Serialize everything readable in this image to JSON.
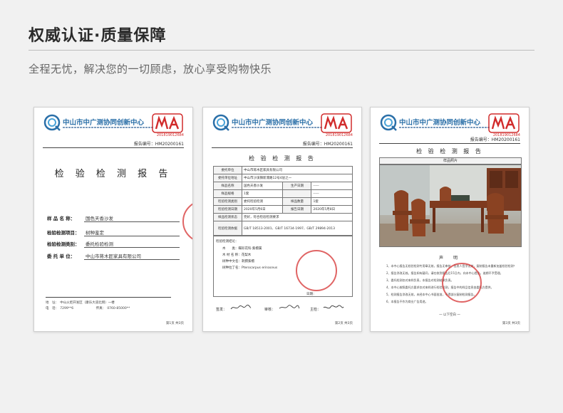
{
  "header": {
    "title": "权威认证·质量保障",
    "subtitle": "全程无忧，解决您的一切顾虑，放心享受购物快乐"
  },
  "doc_common": {
    "org_name": "中山市中广测协同创新中心",
    "cma_code": "201819012684",
    "report_no": "报告编号：HM20200161"
  },
  "doc1": {
    "title": "检 验 检 测 报 告",
    "fields": [
      {
        "label": "样 品 名 称：",
        "value": "国色天香沙发"
      },
      {
        "label": "检验检测项目：",
        "value": "树种鉴定"
      },
      {
        "label": "检验检测类别：",
        "value": "委托检验检测"
      },
      {
        "label": "委  托  单  位：",
        "value": "中山市蒋木匠家具有限公司"
      }
    ],
    "footer_lines": [
      "地　址：　中山火炬开发区（康乐大道北侧）一楼",
      "电　话：　7299**6　　　　　　　传真：　0760-85000**"
    ],
    "page": "第1页 共3页"
  },
  "doc2": {
    "title": "检 验 检 测 报 告",
    "rows": [
      [
        "委托单位",
        "中山市蒋木匠家具有限公司",
        "",
        ""
      ],
      [
        "委托单位地址",
        "中山市沙溪镇新濠路12号4层之一",
        "",
        ""
      ],
      [
        "样品名称",
        "国色天香沙发",
        "生产日期",
        "-----"
      ],
      [
        "样品规格",
        "1套",
        "",
        "-----"
      ],
      [
        "检验检测类别",
        "委托检验检测",
        "样品数量",
        "1套"
      ],
      [
        "检验检测日期",
        "2020年5月6日",
        "报告日期",
        "2020年5月8日"
      ],
      [
        "样品检测状态",
        "完好，符合检验检测要求",
        "",
        ""
      ],
      [
        "检验检测依据",
        "GB/T 18513-2001、GB/T 16734-1997、GB/T 29894-2013",
        "",
        ""
      ]
    ],
    "methods_title": "检验检测结论：",
    "methods_lines": [
      "检验检测结论：",
      "木　　类：蝶形花科·紫檀属",
      "木 材 名 称：花梨木",
      "树种中文名：刺猬紫檀",
      "树种拉丁名：Pterocarpus erinaceus"
    ],
    "date_label": "日期：",
    "sign_labels": [
      "签发：",
      "审核：",
      "主检："
    ],
    "page": "第2页 共3页"
  },
  "doc3": {
    "title": "检 验 检 测 报 告",
    "photo_label": "样品照片",
    "decl_title": "声　明",
    "decl_lines": [
      "1、本中心报告无检验检测专用章无效，报告无审核、签发人签字无效，复制报告未重新加盖检验检测专用章无效。",
      "2、报告涂改无效。报告如有疑问，请在收到报告后15日内，向本中心提出，逾期不予受理。",
      "3、委托检测仅对来样负责，本报告对检测结果负责。",
      "4、本中心按照委托方要求仅对来样进行检验检测，报告中的样品信息由委托方提供。",
      "5、检测报告涂改无效，未经本中心书面批准，不得部分复制检测报告。",
      "6、本报告不作为商业广告用途。"
    ],
    "decl_end": "一 以下空白 一",
    "page": "第3页 共3页"
  },
  "colors": {
    "background": "#f1f1f1",
    "org_blue": "#2a6fa8",
    "seal_red": "#d63232"
  }
}
